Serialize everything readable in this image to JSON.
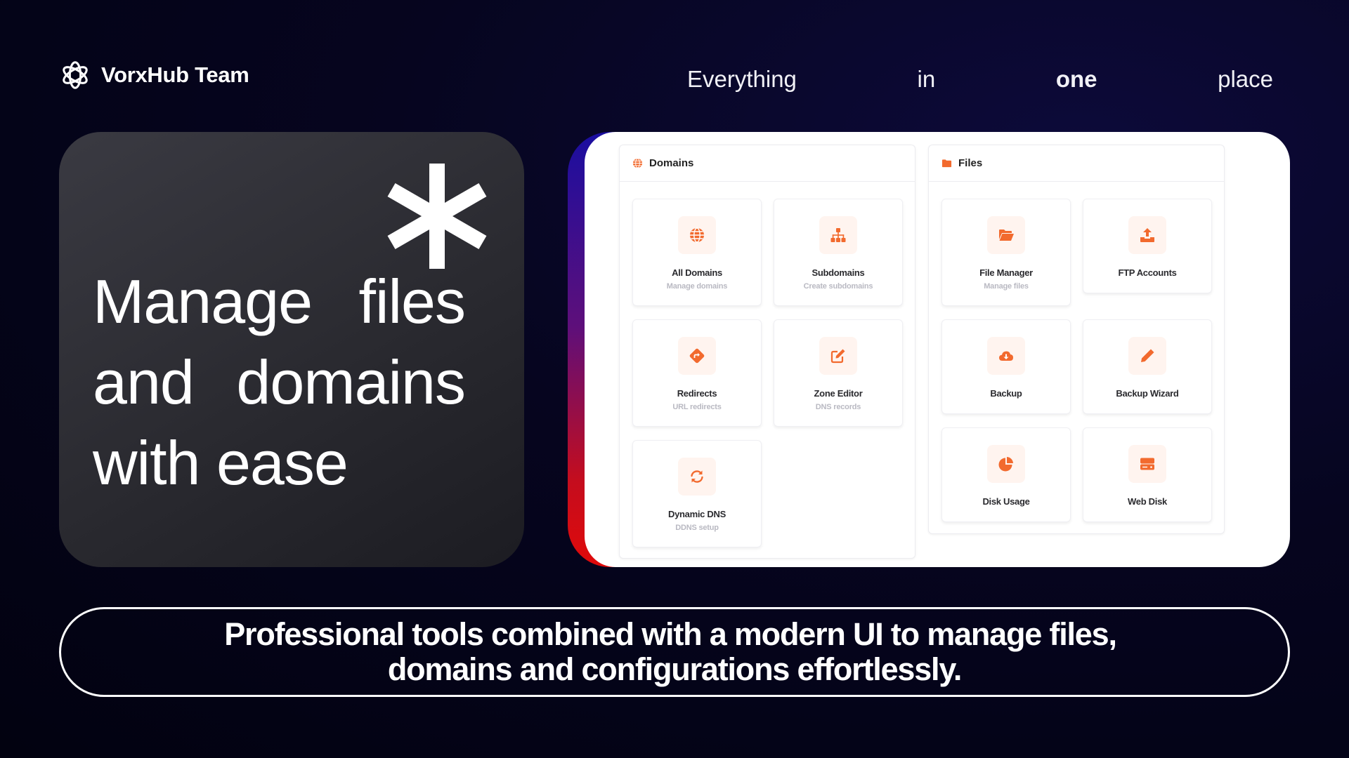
{
  "brand": {
    "name": "VorxHub Team",
    "icon": "gear-flower-logo-icon"
  },
  "tagline": {
    "words": [
      "Everything",
      "in",
      "one",
      "place"
    ]
  },
  "hero": {
    "line1": [
      "Manage",
      "files"
    ],
    "line2": [
      "and",
      "domains"
    ],
    "line3": "with ease",
    "decoration": "asterisk-icon"
  },
  "panel": {
    "domains": {
      "title": "Domains",
      "icon": "globe-icon",
      "tiles": [
        {
          "title": "All Domains",
          "subtitle": "Manage domains",
          "icon": "globe-icon"
        },
        {
          "title": "Subdomains",
          "subtitle": "Create subdomains",
          "icon": "sitemap-icon"
        },
        {
          "title": "Redirects",
          "subtitle": "URL redirects",
          "icon": "redirect-arrow-icon"
        },
        {
          "title": "Zone Editor",
          "subtitle": "DNS records",
          "icon": "edit-icon"
        },
        {
          "title": "Dynamic DNS",
          "subtitle": "DDNS setup",
          "icon": "sync-icon"
        }
      ]
    },
    "files": {
      "title": "Files",
      "icon": "folder-icon",
      "tiles": [
        {
          "title": "File Manager",
          "subtitle": "Manage files",
          "icon": "folder-open-icon"
        },
        {
          "title": "FTP Accounts",
          "subtitle": "",
          "icon": "upload-icon"
        },
        {
          "title": "Backup",
          "subtitle": "",
          "icon": "cloud-download-icon"
        },
        {
          "title": "Backup Wizard",
          "subtitle": "",
          "icon": "pencil-icon"
        },
        {
          "title": "Disk Usage",
          "subtitle": "",
          "icon": "pie-chart-icon"
        },
        {
          "title": "Web Disk",
          "subtitle": "",
          "icon": "hard-drive-icon"
        }
      ]
    },
    "accent_color": "#f26a2e"
  },
  "footer": {
    "line1": "Professional tools combined with a modern UI to manage files,",
    "line2": "domains and configurations effortlessly."
  }
}
